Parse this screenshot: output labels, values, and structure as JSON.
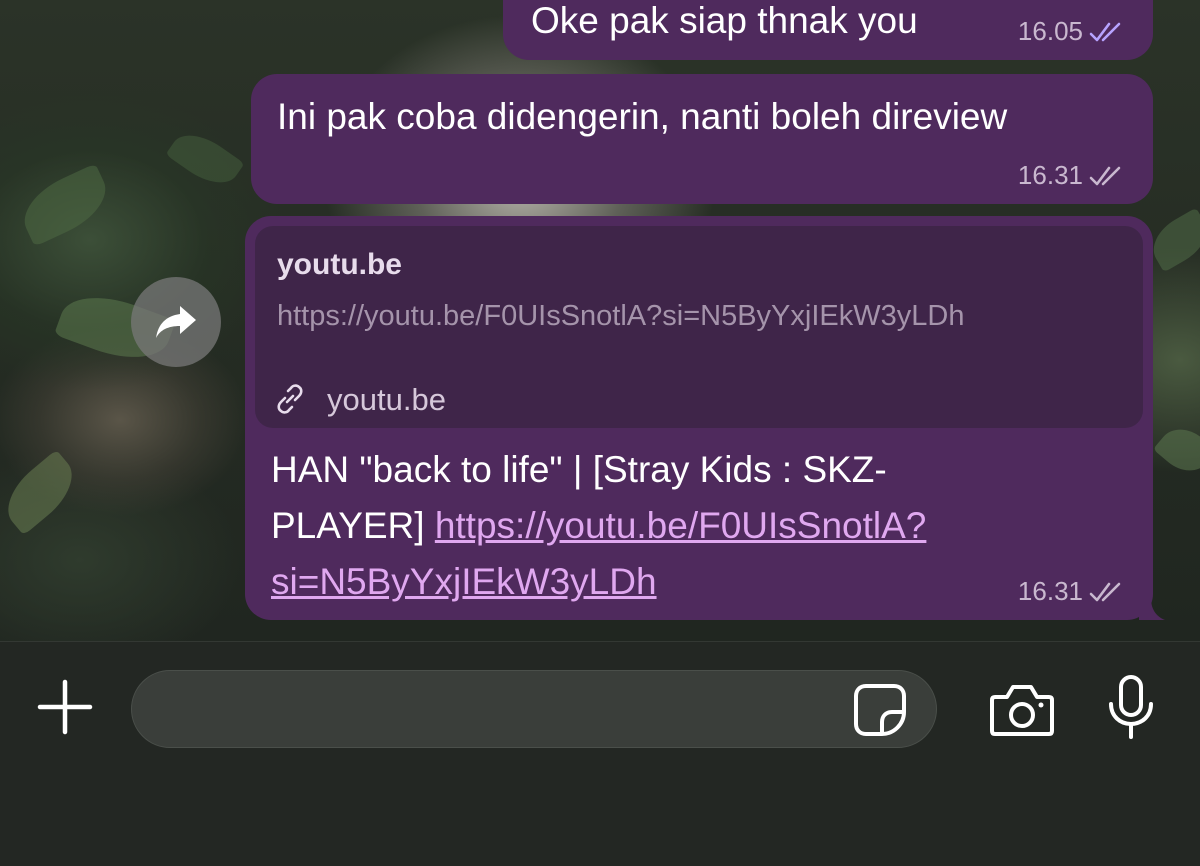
{
  "messages": [
    {
      "text": "Oke pak siap thnak you",
      "time": "16.05",
      "status": "read"
    },
    {
      "text": "Ini pak coba didengerin, nanti boleh direview",
      "time": "16.31",
      "status": "delivered"
    },
    {
      "preview": {
        "title": "youtu.be",
        "url": "https://youtu.be/F0UIsSnotlA?si=N5ByYxjIEkW3yLDh",
        "domain": "youtu.be"
      },
      "text_line1": "HAN \"back to life\" | [Stray Kids : SKZ-",
      "text_line2_prefix": "PLAYER] ",
      "link_part1": "https://youtu.be/F0UIsSnotlA?",
      "link_part2": "si=N5ByYxjIEkW3yLDh",
      "time": "16.31",
      "status": "delivered"
    }
  ],
  "input": {
    "placeholder": "",
    "value": ""
  },
  "icons": {
    "forward": "forward-arrow-icon",
    "plus": "plus-icon",
    "sticker": "sticker-icon",
    "camera": "camera-icon",
    "mic": "microphone-icon",
    "link": "link-icon"
  },
  "colors": {
    "bubble": "#4f2a5d",
    "preview": "#3f2549",
    "link": "#e0a8f0",
    "read_ticks": "#b7a3ff"
  }
}
